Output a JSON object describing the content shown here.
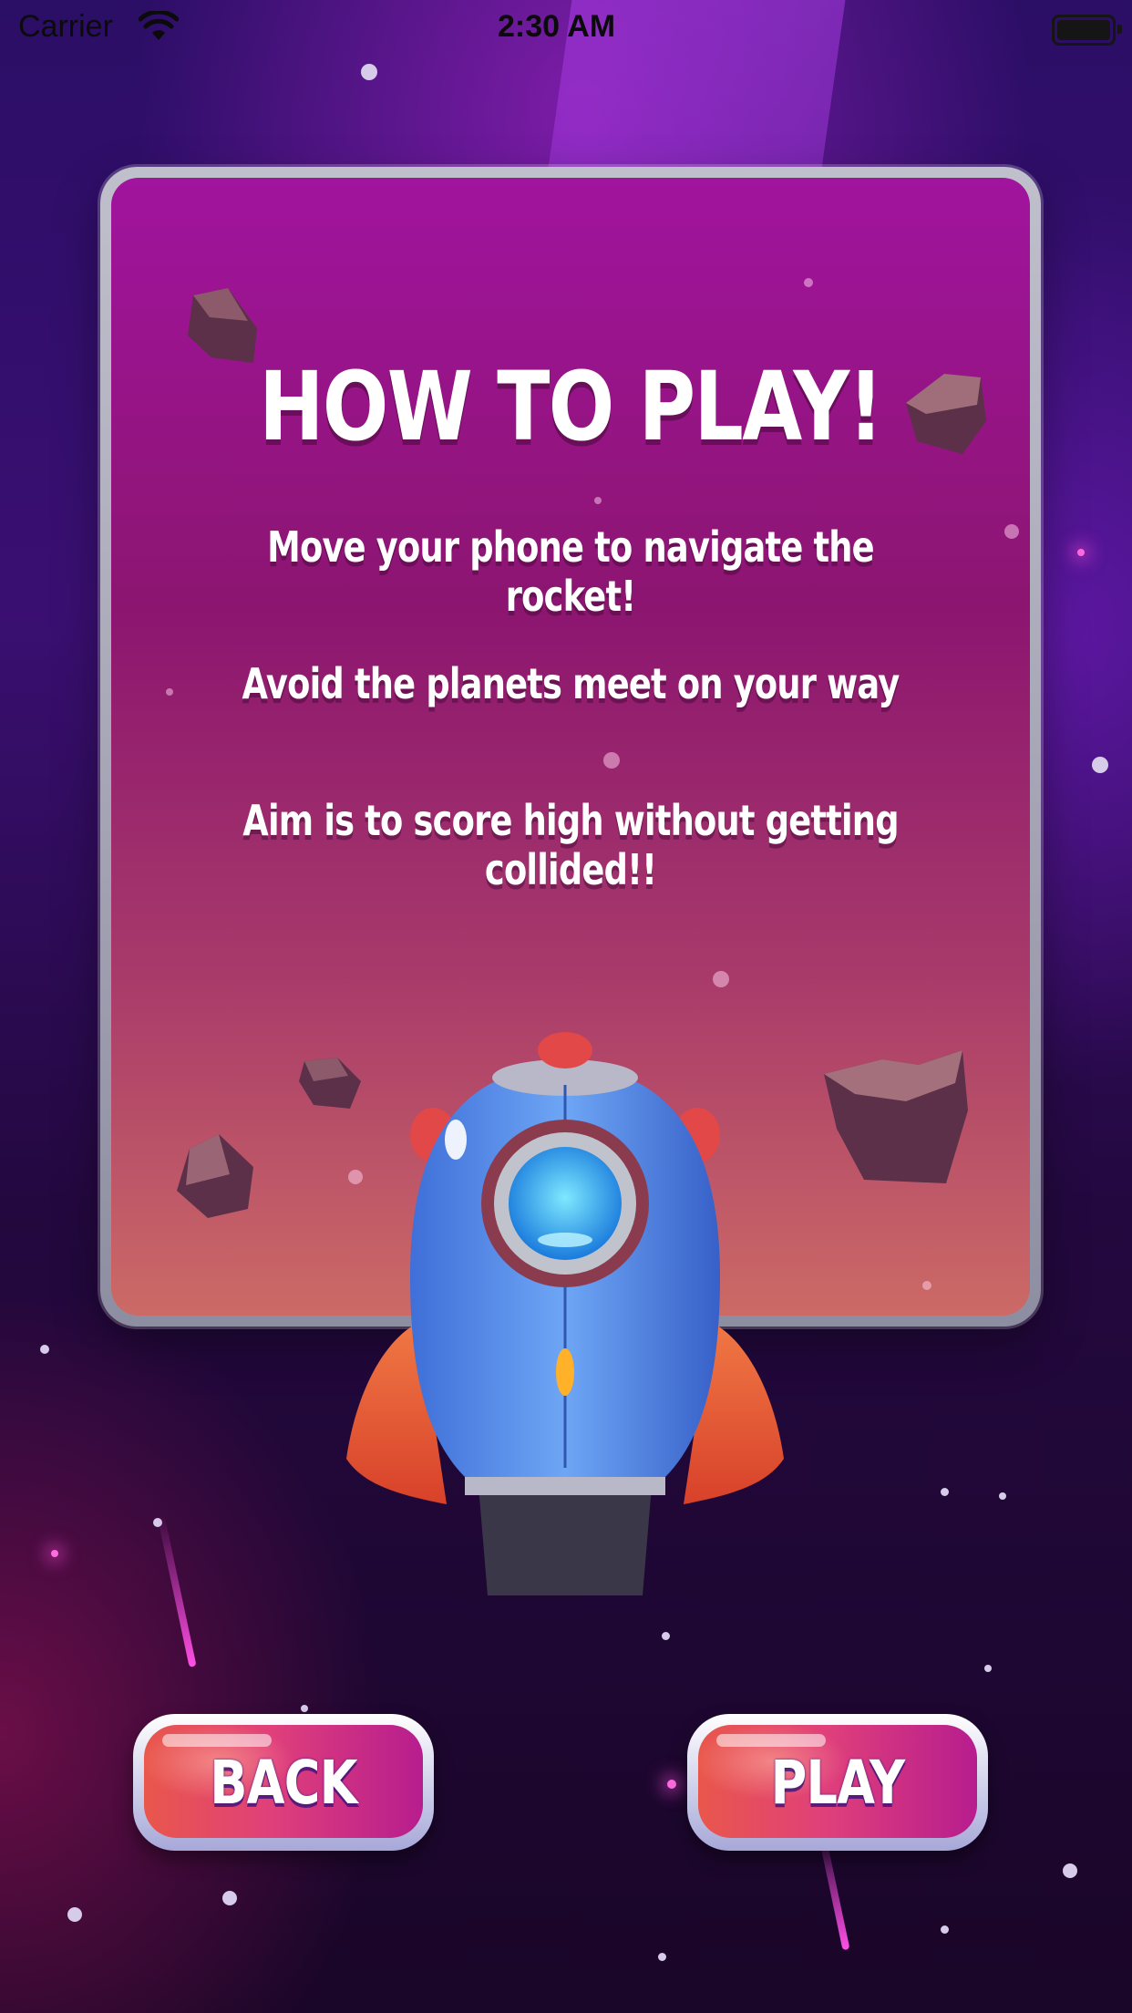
{
  "status_bar": {
    "carrier": "Carrier",
    "time": "2:30 AM",
    "wifi_icon": "wifi-icon",
    "battery_icon": "battery-icon"
  },
  "card": {
    "title": "HOW TO PLAY!",
    "instructions": [
      "Move your phone to navigate the rocket!",
      "Avoid the planets meet on your way",
      "Aim is to score high without getting collided!!"
    ]
  },
  "buttons": {
    "back_label": "BACK",
    "play_label": "PLAY"
  },
  "colors": {
    "card_top": "#a1149e",
    "card_bottom": "#cc6a66",
    "button_red": "#e9574b",
    "button_magenta": "#b71d8e",
    "rocket_body": "#4d8df0"
  }
}
